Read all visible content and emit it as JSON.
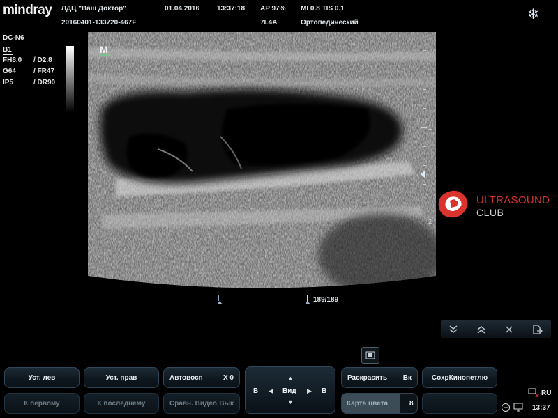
{
  "header": {
    "brand": "mindray",
    "clinic": "ЛДЦ \"Ваш Доктор\"",
    "patient_id": "20160401-133720-467F",
    "date": "01.04.2016",
    "time": "13:37:18",
    "ap": "AP  97%",
    "mi_tis": "MI 0.8  TIS 0.1",
    "probe": "7L4A",
    "exam": "Ортопедический",
    "freeze_icon": "snowflake-icon"
  },
  "params": {
    "preset": "DC-N6",
    "mode": "B1",
    "rows": [
      {
        "a": "FH8.0",
        "b": "/ D2.8"
      },
      {
        "a": "G64",
        "b": "/ FR47"
      },
      {
        "a": "IP5",
        "b": "/ DR90"
      }
    ]
  },
  "image": {
    "marker": "M",
    "depth_labels": [
      "1",
      "2"
    ]
  },
  "watermark": {
    "line1": "ULTRASOUND",
    "line2": "CLUB",
    "logo_icon": "ultrasound-club-logo-icon"
  },
  "cine": {
    "frames": "189/189"
  },
  "nav": {
    "icons": [
      "double-chevron-down-icon",
      "double-chevron-up-icon",
      "close-icon",
      "export-icon"
    ]
  },
  "film_icon": "film-strip-icon",
  "buttons": {
    "set_left": "Уст. лев",
    "set_right": "Уст. прав",
    "autoplay": "Автовосп",
    "autoplay_val": "X 0",
    "colorize": "Раскрасить",
    "colorize_val": "Вк",
    "save_cine": "СохрКинопетлю",
    "to_first": "К первому",
    "to_last": "К последнему",
    "compare_video": "Сравн. Видео",
    "compare_val": "Вык",
    "color_map": "Карта цвета",
    "color_map_val": "8",
    "color_map_level": 0.78
  },
  "dpad": {
    "label": "Вид",
    "left": "B",
    "right": "B"
  },
  "tray": {
    "lang": "RU",
    "clock": "13:37"
  }
}
